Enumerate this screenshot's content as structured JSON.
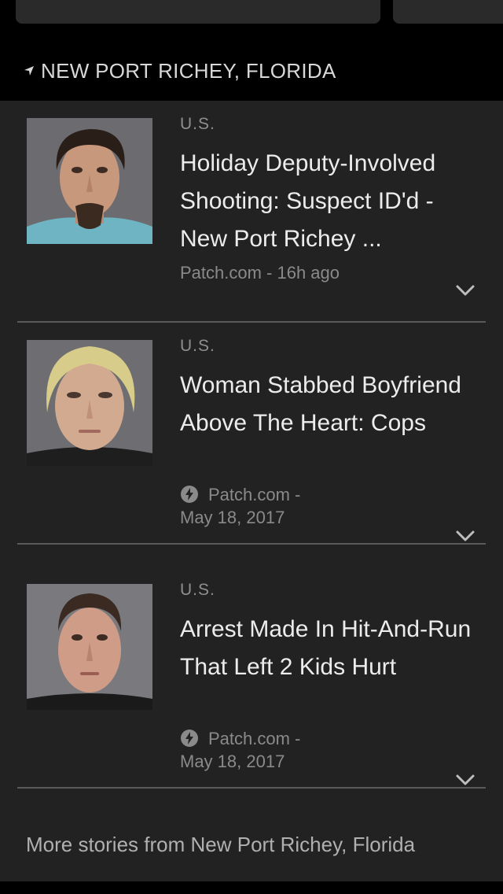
{
  "section": {
    "title": "NEW PORT RICHEY, FLORIDA",
    "location_icon": "location-arrow-icon"
  },
  "stories": [
    {
      "category": "U.S.",
      "headline": "Holiday Deputy-Involved Shooting: Suspect ID'd - New Port Richey ...",
      "source": "Patch.com - 16h ago",
      "amp": false
    },
    {
      "category": "U.S.",
      "headline": "Woman Stabbed Boyfriend Above The Heart: Cops",
      "source": "Patch.com -",
      "date": "May 18, 2017",
      "amp": true
    },
    {
      "category": "U.S.",
      "headline": "Arrest Made In Hit-And-Run That Left 2 Kids Hurt",
      "source": "Patch.com -",
      "date": "May 18, 2017",
      "amp": true
    }
  ],
  "footer": {
    "more_stories_label": "More stories from New Port Richey, Florida"
  },
  "colors": {
    "background": "#000000",
    "panel": "#222222",
    "divider": "#5a5a5a",
    "headline": "#ececec",
    "meta": "#8a8a8a"
  }
}
